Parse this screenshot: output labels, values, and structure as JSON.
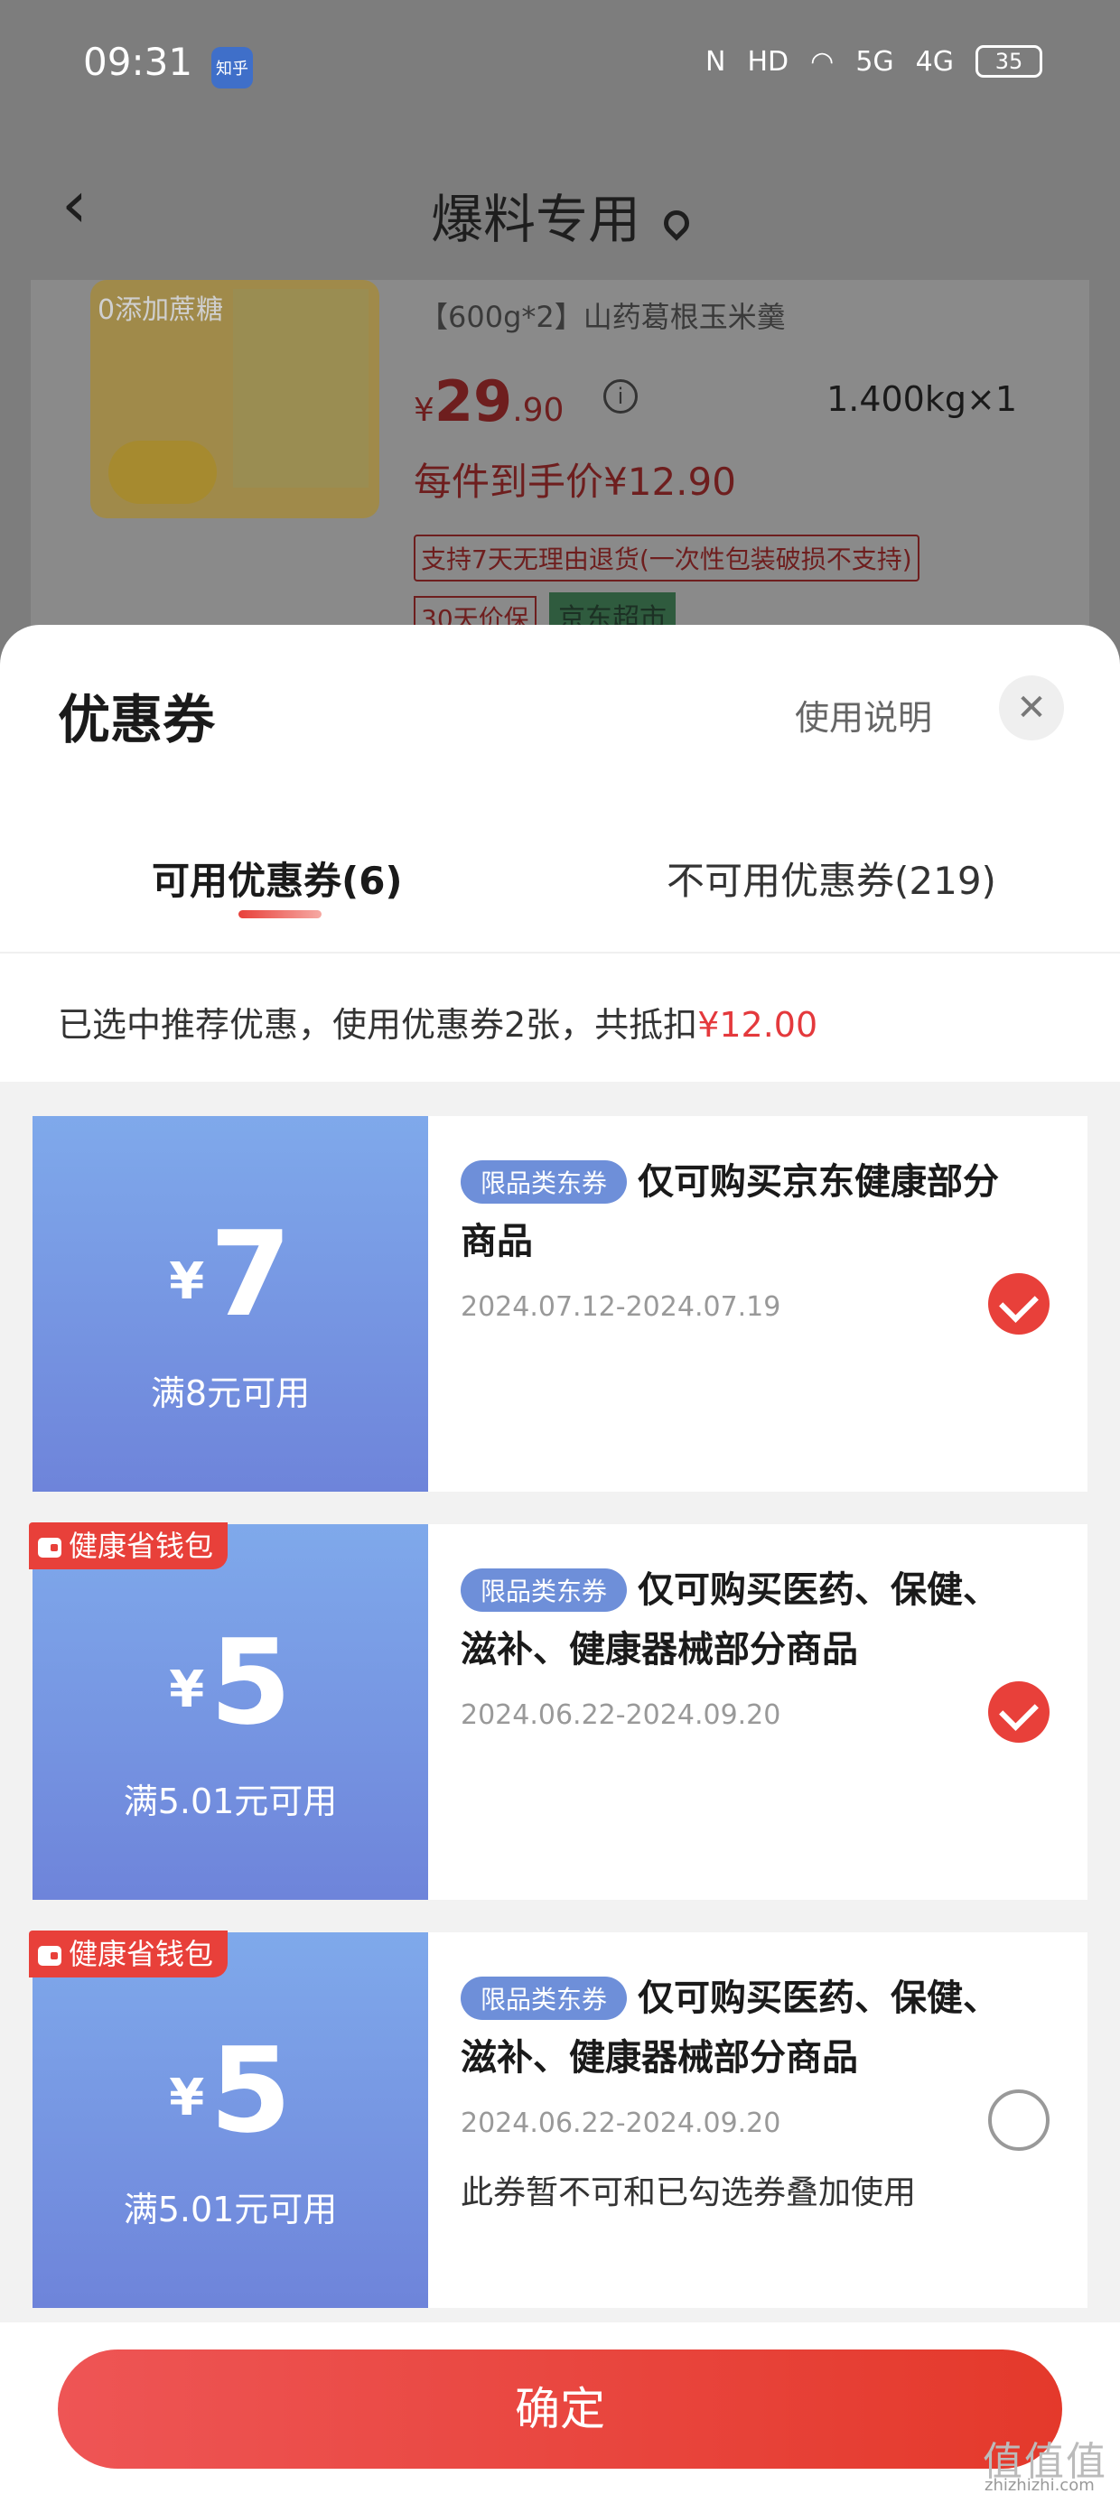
{
  "status_bar": {
    "time": "09:31",
    "app_badge": "知乎",
    "network": "5G",
    "network2": "4G",
    "battery": "35"
  },
  "nav": {
    "title": "爆料专用"
  },
  "product": {
    "name": "【600g*2】山药葛根玉米羹",
    "image_tag": "0添加蔗糖",
    "price_symbol": "¥",
    "price_int": "29",
    "price_dec": ".90",
    "weight": "1.400kg×1",
    "final_price": "每件到手价¥12.90",
    "return_policy": "支持7天无理由退货(一次性包装破损不支持)",
    "badge_price_protect": "30天价保",
    "badge_store": "京东超市"
  },
  "sheet": {
    "title": "优惠券",
    "help": "使用说明",
    "close": "✕",
    "tabs": [
      {
        "label": "可用优惠券(6)"
      },
      {
        "label": "不可用优惠券(219)"
      }
    ],
    "summary_prefix": "已选中推荐优惠，使用优惠券2张，共抵扣",
    "summary_amount": "¥12.00",
    "confirm": "确定"
  },
  "coupons": [
    {
      "yen": "¥",
      "amount": "7",
      "condition": "满8元可用",
      "type": "限品类东券",
      "desc": "仅可购买京东健康部分商品",
      "date": "2024.07.12-2024.07.19",
      "checked": true
    },
    {
      "wallet_tag": "健康省钱包",
      "yen": "¥",
      "amount": "5",
      "condition": "满5.01元可用",
      "type": "限品类东券",
      "desc": "仅可购买医药、保健、滋补、健康器械部分商品",
      "date": "2024.06.22-2024.09.20",
      "checked": true
    },
    {
      "wallet_tag": "健康省钱包",
      "yen": "¥",
      "amount": "5",
      "condition": "满5.01元可用",
      "type": "限品类东券",
      "desc": "仅可购买医药、保健、滋补、健康器械部分商品",
      "date": "2024.06.22-2024.09.20",
      "note": "此券暂不可和已勾选券叠加使用",
      "checked": false
    }
  ],
  "watermark": {
    "logo": "值值值",
    "site": "zhizhizhi.com"
  },
  "colors": {
    "accent": "#e8403a",
    "coupon_blue": "#6e84da"
  }
}
